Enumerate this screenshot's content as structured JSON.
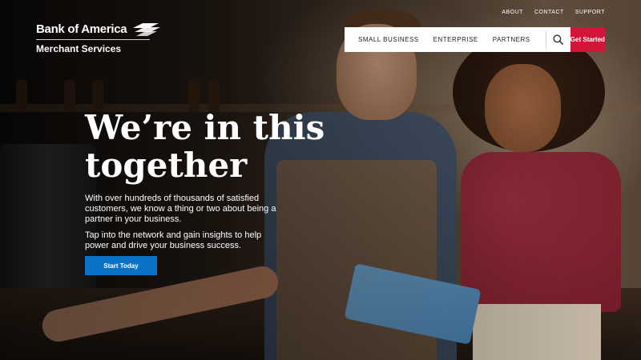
{
  "logo": {
    "name": "Bank of America",
    "subtitle": "Merchant Services"
  },
  "utility_nav": [
    "ABOUT",
    "CONTACT",
    "SUPPORT"
  ],
  "main_nav": {
    "items": [
      "SMALL BUSINESS",
      "ENTERPRISE",
      "PARTNERS"
    ],
    "search_icon": "search-icon",
    "cta_label": "Get Started"
  },
  "hero": {
    "headline": "We’re in this together",
    "paragraph1": "With over hundreds of thousands of satisfied customers, we know a thing or two about being a partner in your business.",
    "paragraph2": "Tap into the network and gain insights to help power and drive your business success.",
    "button_label": "Start Today"
  },
  "colors": {
    "cta_red": "#d4153a",
    "button_blue": "#0a73c7",
    "nav_bg": "#ffffff"
  }
}
